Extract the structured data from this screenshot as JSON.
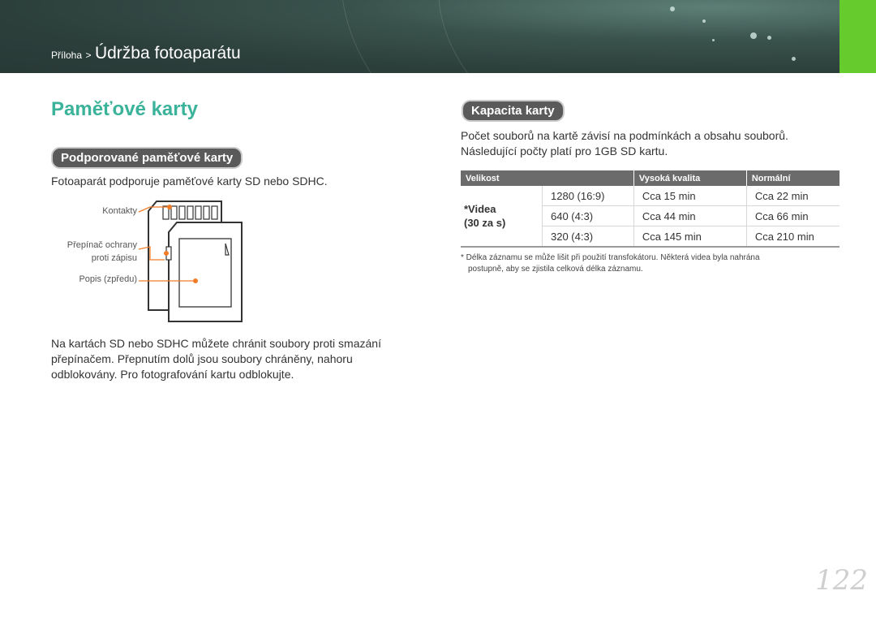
{
  "header": {
    "breadcrumb_parent": "Příloha",
    "breadcrumb_sep": ">",
    "breadcrumb_current": "Údržba fotoaparátu"
  },
  "left": {
    "title": "Paměťové karty",
    "section_heading": "Podporované paměťové karty",
    "intro": "Fotoaparát podporuje paměťové karty SD nebo SDHC.",
    "diagram_labels": {
      "contacts": "Kontakty",
      "protect_line1": "Přepínač ochrany",
      "protect_line2": "proti zápisu",
      "label": "Popis (zpředu)"
    },
    "body": "Na kartách SD nebo SDHC můžete chránit soubory proti smazání přepínačem. Přepnutím dolů jsou soubory chráněny, nahoru odblokovány. Pro fotografování kartu odblokujte."
  },
  "right": {
    "section_heading": "Kapacita karty",
    "intro_line1": "Počet souborů na kartě závisí na podmínkách a obsahu souborů.",
    "intro_line2": "Následující počty platí pro 1GB SD kartu.",
    "table": {
      "headers": [
        "Velikost",
        "Vysoká kvalita",
        "Normální"
      ],
      "category_line1": "*Videa",
      "category_line2": "(30 za s)",
      "rows": [
        {
          "size": "1280 (16:9)",
          "high": "Cca 15 min",
          "normal": "Cca 22 min"
        },
        {
          "size": "640 (4:3)",
          "high": "Cca 44 min",
          "normal": "Cca 66 min"
        },
        {
          "size": "320 (4:3)",
          "high": "Cca 145 min",
          "normal": "Cca 210 min"
        }
      ]
    },
    "footnote_line1": "* Délka záznamu se může lišit při použití transfokátoru. Některá videa byla nahrána",
    "footnote_line2": "postupně, aby se zjistila celková délka záznamu."
  },
  "page_number": "122",
  "colors": {
    "accent_title": "#3ab39a",
    "green_tab": "#66cc2e",
    "header_bg": "#2e4440",
    "callout_orange": "#f07c28"
  }
}
